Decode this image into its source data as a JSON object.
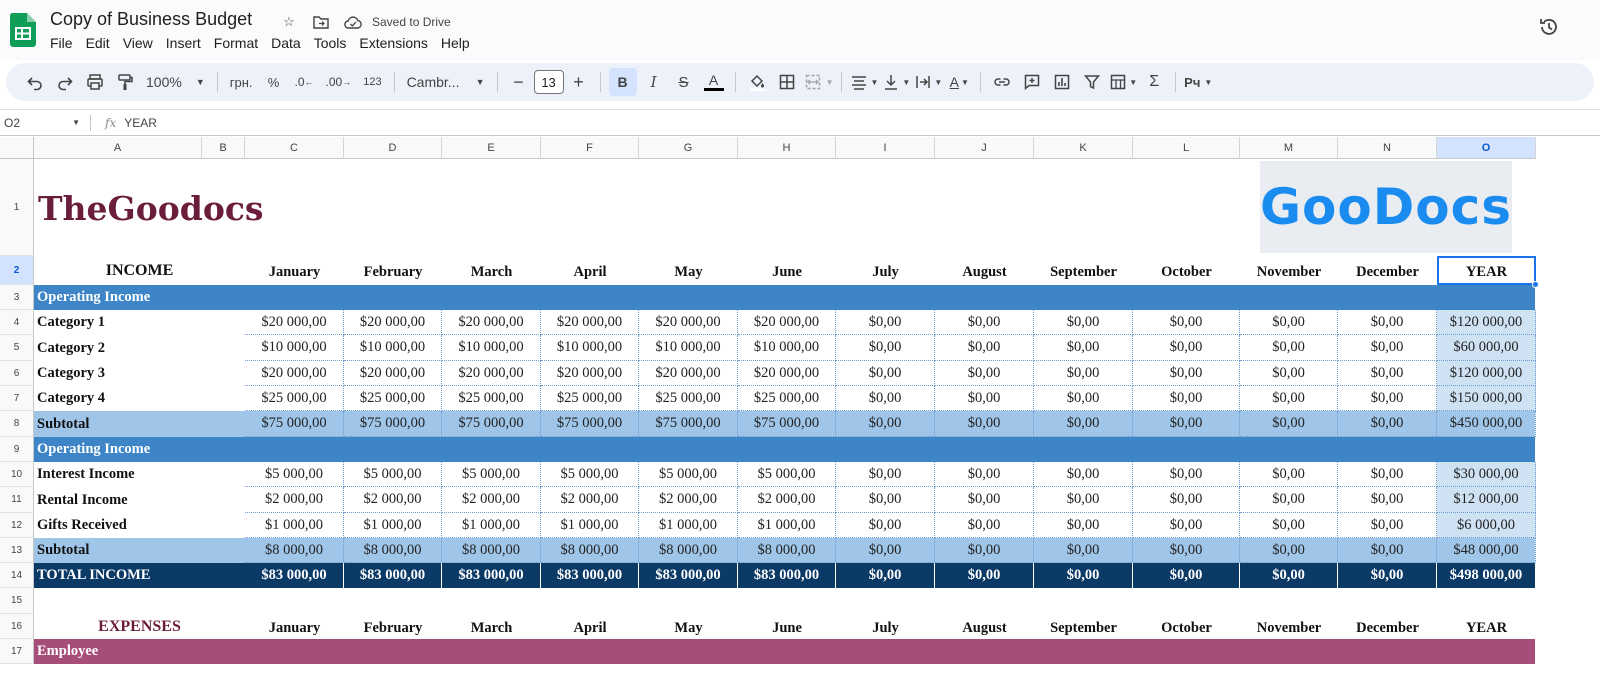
{
  "doc": {
    "title": "Copy of Business Budget",
    "saved_status": "Saved to Drive"
  },
  "menu": [
    "File",
    "Edit",
    "View",
    "Insert",
    "Format",
    "Data",
    "Tools",
    "Extensions",
    "Help"
  ],
  "toolbar": {
    "zoom": "100%",
    "currency": "грн.",
    "percent": "%",
    "dec_decrease": ".0",
    "dec_increase": ".00",
    "format_123": "123",
    "font": "Cambr...",
    "font_size": "13"
  },
  "formula_bar": {
    "cell_ref": "O2",
    "fx": "fx",
    "value": "YEAR"
  },
  "columns": [
    "A",
    "B",
    "C",
    "D",
    "E",
    "F",
    "G",
    "H",
    "I",
    "J",
    "K",
    "L",
    "M",
    "N",
    "O"
  ],
  "rows": [
    "1",
    "2",
    "3",
    "4",
    "5",
    "6",
    "7",
    "8",
    "9",
    "10",
    "11",
    "12",
    "13",
    "14",
    "15",
    "16",
    "17"
  ],
  "sheet": {
    "brand_text": "TheGoodocs",
    "logo_text": "GooDocs",
    "months": [
      "January",
      "February",
      "March",
      "April",
      "May",
      "June",
      "July",
      "August",
      "September",
      "October",
      "November",
      "December",
      "YEAR"
    ],
    "income_header": "INCOME",
    "expenses_header": "EXPENSES",
    "section_operating": "Operating Income",
    "section_operating_2": "Operating Income",
    "section_employee": "Employee",
    "income_rows": [
      {
        "label": "Category 1",
        "values": [
          "$20 000,00",
          "$20 000,00",
          "$20 000,00",
          "$20 000,00",
          "$20 000,00",
          "$20 000,00",
          "$0,00",
          "$0,00",
          "$0,00",
          "$0,00",
          "$0,00",
          "$0,00",
          "$120 000,00"
        ]
      },
      {
        "label": "Category 2",
        "values": [
          "$10 000,00",
          "$10 000,00",
          "$10 000,00",
          "$10 000,00",
          "$10 000,00",
          "$10 000,00",
          "$0,00",
          "$0,00",
          "$0,00",
          "$0,00",
          "$0,00",
          "$0,00",
          "$60 000,00"
        ]
      },
      {
        "label": "Category 3",
        "values": [
          "$20 000,00",
          "$20 000,00",
          "$20 000,00",
          "$20 000,00",
          "$20 000,00",
          "$20 000,00",
          "$0,00",
          "$0,00",
          "$0,00",
          "$0,00",
          "$0,00",
          "$0,00",
          "$120 000,00"
        ]
      },
      {
        "label": "Category 4",
        "values": [
          "$25 000,00",
          "$25 000,00",
          "$25 000,00",
          "$25 000,00",
          "$25 000,00",
          "$25 000,00",
          "$0,00",
          "$0,00",
          "$0,00",
          "$0,00",
          "$0,00",
          "$0,00",
          "$150 000,00"
        ]
      }
    ],
    "subtotal_1": {
      "label": "Subtotal",
      "values": [
        "$75 000,00",
        "$75 000,00",
        "$75 000,00",
        "$75 000,00",
        "$75 000,00",
        "$75 000,00",
        "$0,00",
        "$0,00",
        "$0,00",
        "$0,00",
        "$0,00",
        "$0,00",
        "$450 000,00"
      ]
    },
    "other_rows": [
      {
        "label": "Interest Income",
        "values": [
          "$5 000,00",
          "$5 000,00",
          "$5 000,00",
          "$5 000,00",
          "$5 000,00",
          "$5 000,00",
          "$0,00",
          "$0,00",
          "$0,00",
          "$0,00",
          "$0,00",
          "$0,00",
          "$30 000,00"
        ]
      },
      {
        "label": "Rental Income",
        "values": [
          "$2 000,00",
          "$2 000,00",
          "$2 000,00",
          "$2 000,00",
          "$2 000,00",
          "$2 000,00",
          "$0,00",
          "$0,00",
          "$0,00",
          "$0,00",
          "$0,00",
          "$0,00",
          "$12 000,00"
        ]
      },
      {
        "label": "Gifts Received",
        "values": [
          "$1 000,00",
          "$1 000,00",
          "$1 000,00",
          "$1 000,00",
          "$1 000,00",
          "$1 000,00",
          "$0,00",
          "$0,00",
          "$0,00",
          "$0,00",
          "$0,00",
          "$0,00",
          "$6 000,00"
        ]
      }
    ],
    "subtotal_2": {
      "label": "Subtotal",
      "values": [
        "$8 000,00",
        "$8 000,00",
        "$8 000,00",
        "$8 000,00",
        "$8 000,00",
        "$8 000,00",
        "$0,00",
        "$0,00",
        "$0,00",
        "$0,00",
        "$0,00",
        "$0,00",
        "$48 000,00"
      ]
    },
    "total_income": {
      "label": "TOTAL INCOME",
      "values": [
        "$83 000,00",
        "$83 000,00",
        "$83 000,00",
        "$83 000,00",
        "$83 000,00",
        "$83 000,00",
        "$0,00",
        "$0,00",
        "$0,00",
        "$0,00",
        "$0,00",
        "$0,00",
        "$498 000,00"
      ]
    }
  },
  "colors": {
    "section_blue": "#3d85c6",
    "subtotal_blue": "#9fc5e8",
    "year_col": "#cfe2f3",
    "total_navy": "#0b3a66",
    "brand": "#6b1d3c",
    "employee": "#a64d79",
    "logo": "#1a8cf0"
  }
}
